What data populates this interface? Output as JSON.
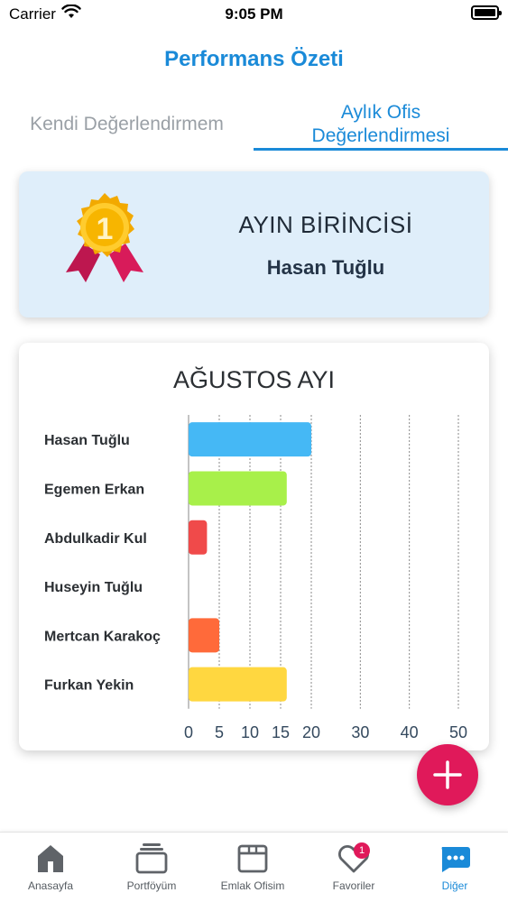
{
  "status_bar": {
    "carrier": "Carrier",
    "time": "9:05 PM"
  },
  "nav": {
    "title": "Performans Özeti"
  },
  "tabs": [
    {
      "label": "Kendi Değerlendirmem",
      "active": false
    },
    {
      "label": "Aylık Ofis Değerlendirmesi",
      "active": true
    }
  ],
  "winner": {
    "title": "AYIN BİRİNCİSİ",
    "name": "Hasan Tuğlu",
    "medal_number": "1"
  },
  "chart_data": {
    "type": "bar",
    "orientation": "horizontal",
    "title": "AĞUSTOS AYI",
    "categories": [
      "Hasan Tuğlu",
      "Egemen Erkan",
      "Abdulkadir Kul",
      "Huseyin Tuğlu",
      "Mertcan Karakoç",
      "Furkan Yekin"
    ],
    "values": [
      20,
      16,
      3,
      0,
      5,
      16
    ],
    "colors": [
      "#45b8f5",
      "#a8f04a",
      "#f04a4a",
      "#cccccc",
      "#ff6a3a",
      "#ffd740"
    ],
    "x_ticks": [
      0,
      5,
      10,
      15,
      20,
      30,
      40,
      50
    ],
    "xlim": [
      0,
      50
    ],
    "grid": "vertical-dotted"
  },
  "fab": {
    "icon": "plus-icon"
  },
  "tabbar": {
    "items": [
      {
        "label": "Anasayfa",
        "icon": "home-icon",
        "active": false
      },
      {
        "label": "Portföyüm",
        "icon": "stack-icon",
        "active": false
      },
      {
        "label": "Emlak Ofisim",
        "icon": "box-icon",
        "active": false
      },
      {
        "label": "Favoriler",
        "icon": "heart-icon",
        "active": false,
        "badge": "1"
      },
      {
        "label": "Diğer",
        "icon": "more-icon",
        "active": true
      }
    ]
  },
  "colors": {
    "accent": "#1a8ad8",
    "fab": "#e0195a",
    "winner_bg": "#dfeefa"
  }
}
